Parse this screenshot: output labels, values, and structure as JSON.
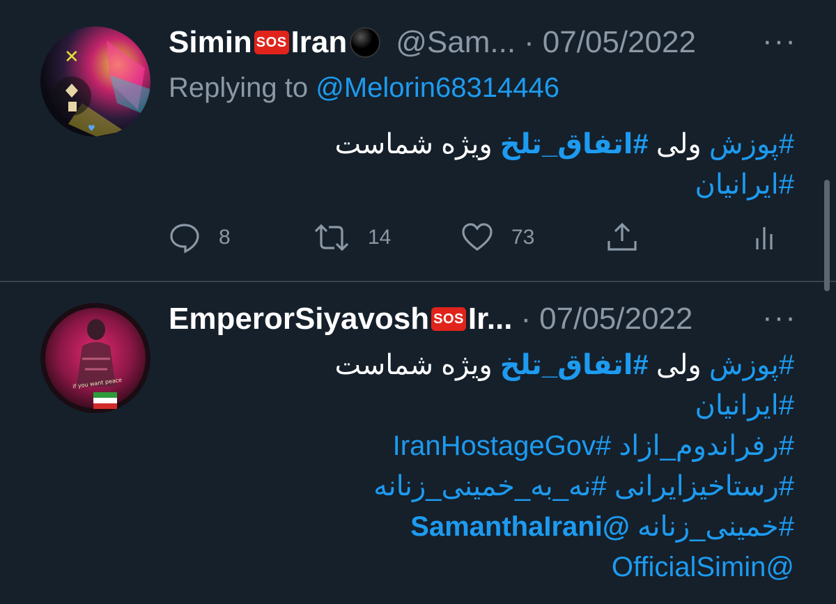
{
  "tweets": [
    {
      "display_name": "Simin",
      "sos": "SOS",
      "name_suffix": "Iran",
      "handle": "@Sam...",
      "dot": "·",
      "date": "07/05/2022",
      "more": "···",
      "replying_prefix": "Replying to",
      "replying_handle": "@Melorin68314446",
      "line1_tag_a": "#پوزش",
      "line1_text_a": " ولی ",
      "line1_tag_b": "#اتفاق_تلخ",
      "line1_text_b": " ویژه شماست",
      "line2_tag": "#ایرانیان",
      "actions": {
        "reply_count": "8",
        "retweet_count": "14",
        "like_count": "73"
      }
    },
    {
      "display_name": "EmperorSiyavosh",
      "sos": "SOS",
      "name_suffix": "Ir...",
      "dot": "·",
      "date": "07/05/2022",
      "more": "···",
      "line1_tag_a": "#پوزش",
      "line1_text_a": " ولی ",
      "line1_tag_b": "#اتفاق_تلخ",
      "line1_text_b": " ویژه شماست",
      "line2_tag": "#ایرانیان",
      "line3": "#رفراندوم_ازاد #IranHostageGov",
      "line4": "#رستاخیزایرانی #نه_به_خمینی_زنانه",
      "line5_tag": "#خمینی_زنانه",
      "line5_mention": "@SamanthaIrani",
      "line6": "@OfficialSimin"
    }
  ],
  "colors": {
    "background": "#15202b",
    "accent": "#1d9bf0",
    "muted": "#8b98a5",
    "divider": "#38444d"
  },
  "icons": [
    "reply-icon",
    "retweet-icon",
    "like-icon",
    "share-icon",
    "analytics-icon",
    "sos-emoji",
    "black-circle-emoji"
  ]
}
